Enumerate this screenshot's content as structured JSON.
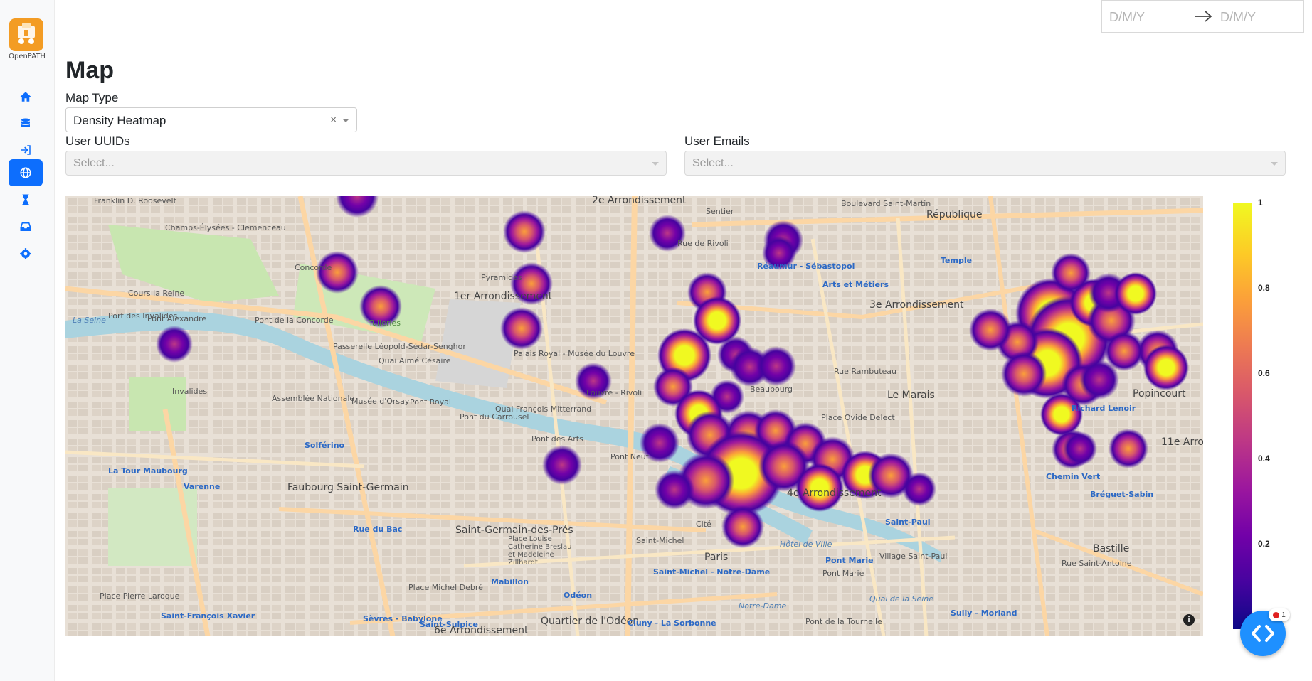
{
  "app": {
    "logo_text": "OpenPATH"
  },
  "sidebar": {
    "items": [
      {
        "icon": "home-icon",
        "active": false
      },
      {
        "icon": "database-icon",
        "active": false
      },
      {
        "icon": "sign-in-icon",
        "active": false
      },
      {
        "icon": "globe-icon",
        "active": true
      },
      {
        "icon": "hourglass-icon",
        "active": false
      },
      {
        "icon": "inbox-icon",
        "active": false
      },
      {
        "icon": "gear-icon",
        "active": false
      }
    ]
  },
  "date_range": {
    "start_placeholder": "D/M/Y",
    "end_placeholder": "D/M/Y"
  },
  "page": {
    "title": "Map"
  },
  "filters": {
    "map_type": {
      "label": "Map Type",
      "value": "Density Heatmap",
      "clear": "×"
    },
    "user_uuids": {
      "label": "User UUIDs",
      "placeholder": "Select..."
    },
    "user_emails": {
      "label": "User Emails",
      "placeholder": "Select..."
    }
  },
  "map": {
    "labels": {
      "l1": "Franklin D. Roosevelt",
      "l2": "Champs-Élysées - Clemenceau",
      "l3": "Concorde",
      "l4": "Tuileries",
      "l5": "Pyramides",
      "l6": "1er Arrondissement",
      "l7": "Palais Royal - Musée du Louvre",
      "l8": "Louvre - Rivoli",
      "l9": "Pont Alexandre",
      "l10": "Pont de la Concorde",
      "l11": "La Seine",
      "l12": "Passerelle Léopold-Sédar-Senghor",
      "l13": "Quai Aimé Césaire",
      "l14": "Musée d'Orsay",
      "l15": "Pont Royal",
      "l16": "Quai François Mitterrand",
      "l17": "Pont du Carrousel",
      "l18": "Pont des Arts",
      "l19": "Pont Neuf",
      "l20": "Invalides",
      "l21": "Assemblée Nationale",
      "l22": "Solférino",
      "l23": "La Tour Maubourg",
      "l24": "Varenne",
      "l25": "Faubourg Saint-Germain",
      "l26": "Saint-Germain-des-Prés",
      "l27": "Mabillon",
      "l28": "Odéon",
      "l29": "Saint-Michel",
      "l30": "Saint-Michel - Notre-Dame",
      "l31": "Cité",
      "l32": "Paris",
      "l33": "Hôtel de Ville",
      "l34": "Pont Marie",
      "l35": "Village Saint-Paul",
      "l36": "Le Marais",
      "l37": "3e Arrondissement",
      "l38": "Arts et Métiers",
      "l39": "Beaubourg",
      "l40": "Réaumur - Sébastopol",
      "l41": "Sentier",
      "l42": "République",
      "l43": "Temple",
      "l44": "Richard Lenoir",
      "l45": "Popincourt",
      "l46": "Chemin Vert",
      "l47": "Bréguet-Sabin",
      "l48": "Bastille",
      "l49": "Sully - Morland",
      "l50": "Sèvres - Babylone",
      "l51": "Saint-François Xavier",
      "l52": "Saint-Sulpice",
      "l53": "Quartier de l'Odéon",
      "l54": "6e Arrondissement",
      "l55": "Cluny - La Sorbonne",
      "l56": "Pont de la Tournelle",
      "l57": "Place Ovide Delect",
      "l58": "Rue Rambuteau",
      "l59": "Boulevard Saint-Martin",
      "l60": "Saint-Paul",
      "l61": "Rue du Bac",
      "l62": "Place Pierre Laroque",
      "l63": "Place Michel Debré",
      "l64": "Place Louise Catherine Breslau et Madeleine Zillhardt",
      "l65": "Pont Marie",
      "l66": "4e Arrondissement",
      "l67": "Notre-Dame",
      "l68": "11e Arron",
      "l69": "2e Arrondissement",
      "l70": "Cours la Reine",
      "l71": "Port des Invalides",
      "l72": "Rue Saint-Antoine",
      "l73": "Rue de Rivoli",
      "l74": "Quai de la Seine"
    },
    "info_icon": "i"
  },
  "colorbar": {
    "ticks": [
      "1",
      "0.8",
      "0.6",
      "0.4",
      "0.2"
    ],
    "range": [
      0,
      1
    ],
    "colorscale": "Plasma"
  },
  "dev_tools": {
    "badge_count": "1",
    "icon": "code-icon"
  }
}
